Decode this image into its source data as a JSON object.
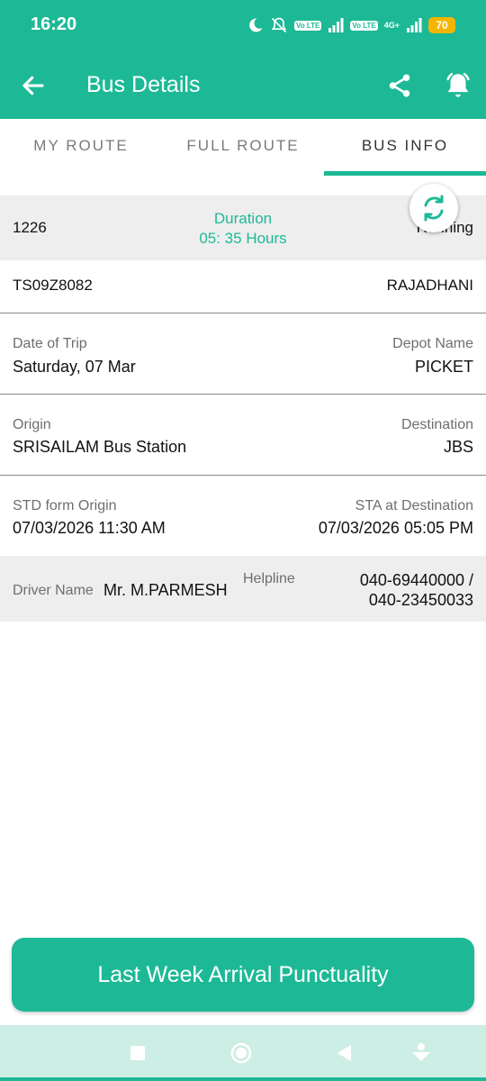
{
  "status_bar": {
    "time": "16:20",
    "badge_1": "Vo LTE",
    "badge_2": "Vo LTE",
    "network_type": "4G+",
    "battery": "70"
  },
  "app_bar": {
    "title": "Bus Details"
  },
  "tabs": [
    {
      "label": "MY ROUTE",
      "active": false
    },
    {
      "label": "FULL ROUTE",
      "active": false
    },
    {
      "label": "BUS INFO",
      "active": true
    }
  ],
  "bus_info": {
    "service_number": "1226",
    "duration_label": "Duration",
    "duration_value": "05: 35 Hours",
    "status": "Running",
    "vehicle_number": "TS09Z8082",
    "bus_type": "RAJADHANI",
    "date_label": "Date of Trip",
    "date_value": "Saturday, 07 Mar",
    "depot_label": "Depot Name",
    "depot_value": "PICKET",
    "origin_label": "Origin",
    "origin_value": "SRISAILAM Bus Station",
    "destination_label": "Destination",
    "destination_value": "JBS",
    "std_label": "STD form Origin",
    "std_value": "07/03/2026 11:30 AM",
    "sta_label": "STA at Destination",
    "sta_value": "07/03/2026 05:05 PM",
    "driver_label": "Driver Name",
    "driver_value": "Mr. M.PARMESH",
    "helpline_label": "Helpline",
    "helpline_value_1": "040-69440000 /",
    "helpline_value_2": "040-23450033"
  },
  "cta": {
    "label": "Last Week Arrival Punctuality"
  },
  "colors": {
    "primary": "#1db996",
    "battery": "#f5b400",
    "row_gray": "#eeeeee",
    "nav_bar": "#cdeee5"
  },
  "icons": [
    "back-arrow-icon",
    "share-icon",
    "bell-alert-icon",
    "refresh-icon",
    "nav-recents-icon",
    "nav-home-icon",
    "nav-back-icon",
    "nav-assistant-icon"
  ]
}
